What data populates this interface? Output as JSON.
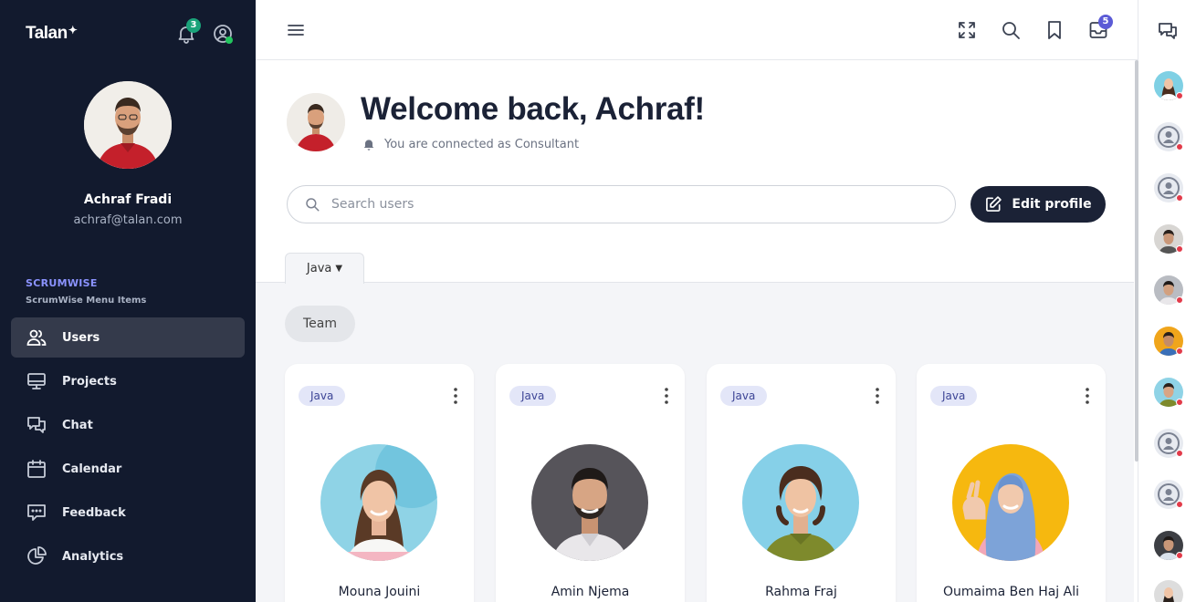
{
  "sidebar": {
    "brand": "Talan",
    "notification_count": "3",
    "user": {
      "name": "Achraf Fradi",
      "email": "achraf@talan.com"
    },
    "section_title": "SCRUMWISE",
    "section_subtitle": "ScrumWise Menu Items",
    "menu": [
      {
        "label": "Users",
        "icon": "users-icon",
        "active": true
      },
      {
        "label": "Projects",
        "icon": "monitor-icon",
        "active": false
      },
      {
        "label": "Chat",
        "icon": "chat-icon",
        "active": false
      },
      {
        "label": "Calendar",
        "icon": "calendar-icon",
        "active": false
      },
      {
        "label": "Feedback",
        "icon": "feedback-icon",
        "active": false
      },
      {
        "label": "Analytics",
        "icon": "pie-chart-icon",
        "active": false
      }
    ]
  },
  "topbar": {
    "inbox_count": "5",
    "icons": [
      "menu-icon",
      "fullscreen-icon",
      "search-icon",
      "bookmark-icon",
      "inbox-icon"
    ]
  },
  "hero": {
    "welcome": "Welcome back, Achraf!",
    "connected_text": "You are connected as Consultant",
    "search_placeholder": "Search users",
    "edit_profile_label": "Edit profile"
  },
  "filters": {
    "tab_label": "Java",
    "team_chip": "Team"
  },
  "cards": [
    {
      "tag": "Java",
      "name": "Mouna Jouini"
    },
    {
      "tag": "Java",
      "name": "Amin Njema"
    },
    {
      "tag": "Java",
      "name": "Rahma Fraj"
    },
    {
      "tag": "Java",
      "name": "Oumaima Ben Haj Ali"
    }
  ],
  "colors": {
    "sidebar_bg": "#121a2e",
    "accent": "#8b93ff",
    "badge_green": "#1aa37a",
    "badge_indigo": "#5b5bd6",
    "offline_red": "#e23b4a",
    "online_green": "#22c55e"
  }
}
